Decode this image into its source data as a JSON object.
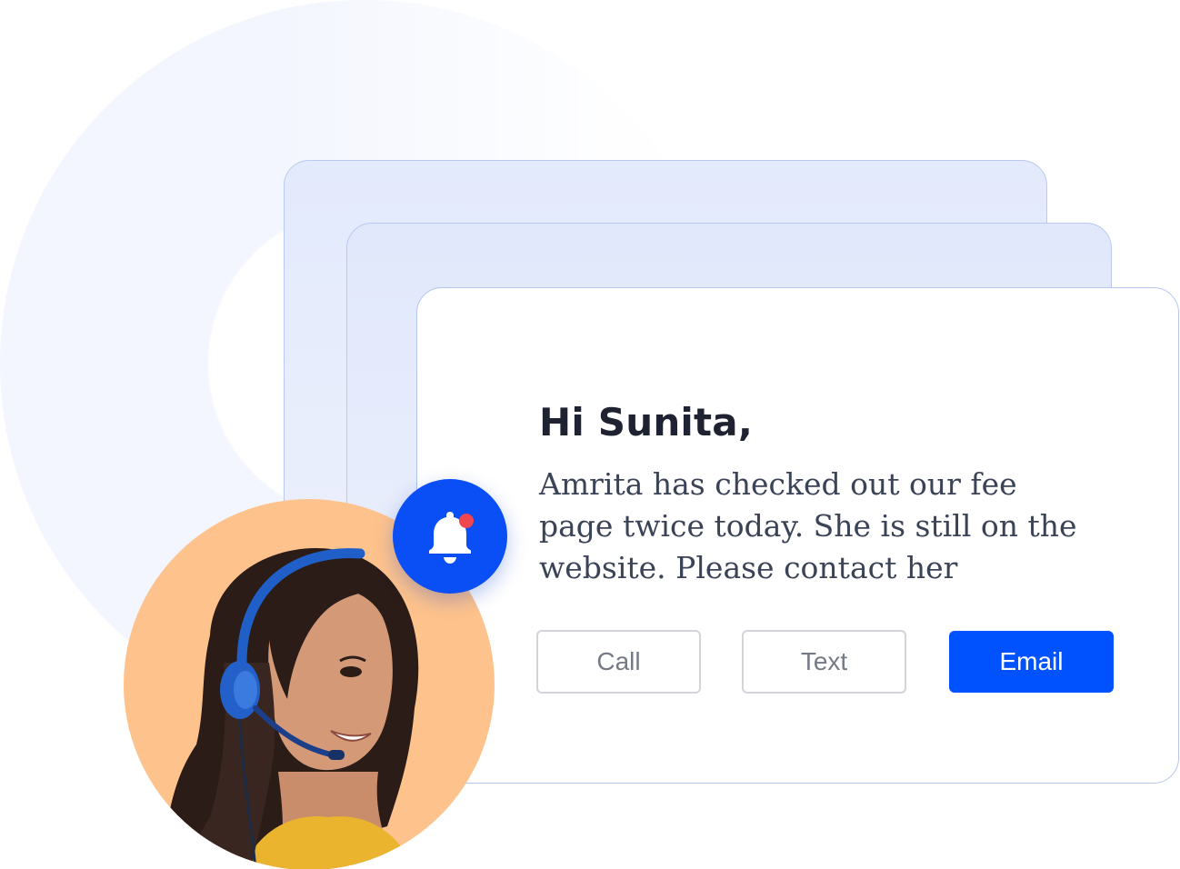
{
  "notification": {
    "greeting": "Hi Sunita,",
    "message": "Amrita has checked out our fee page twice today. She is still on the website. Please contact her",
    "actions": {
      "call_label": "Call",
      "text_label": "Text",
      "email_label": "Email"
    }
  },
  "badge": {
    "icon": "bell-icon",
    "indicator": "unread-dot",
    "color": "#0a4ef5",
    "dot_color": "#f0474f"
  },
  "agent_avatar": {
    "icon": "support-agent-headset",
    "background_color": "#fec38c"
  },
  "colors": {
    "primary": "#0052ff",
    "card_border": "#b5c5ef",
    "heading": "#1f2230",
    "body_text": "#3b4357"
  }
}
